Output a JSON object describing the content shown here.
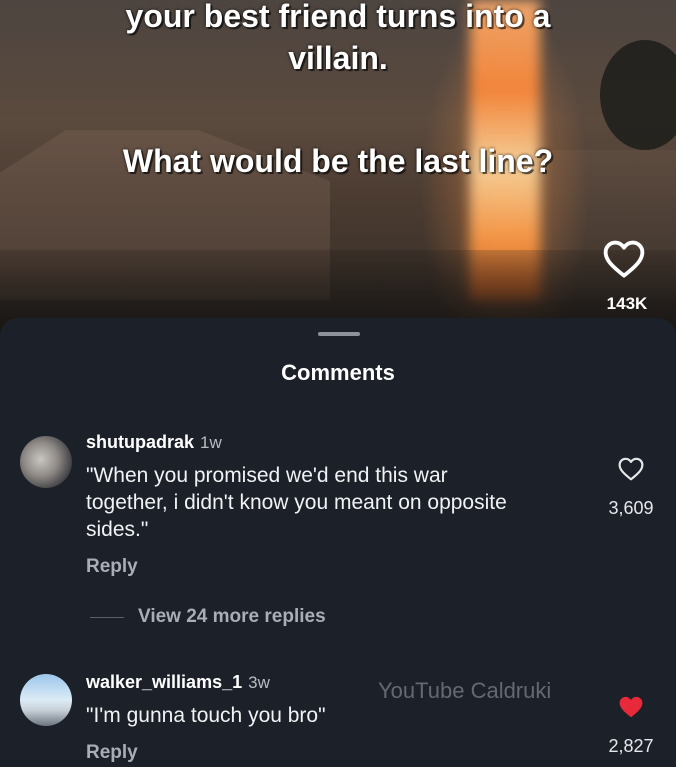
{
  "video": {
    "caption_line1": "your best friend turns into a",
    "caption_line2": "villain.",
    "caption_question": "What would be the last line?",
    "like_icon": "heart-outline-icon",
    "like_count": "143K"
  },
  "comments_sheet": {
    "title": "Comments",
    "comments": [
      {
        "username": "shutupadrak",
        "age": "1w",
        "text_lines": [
          "\"When you promised we'd end this war",
          "together, i didn't know you meant on opposite",
          "sides.\""
        ],
        "reply_label": "Reply",
        "view_more": "View 24 more replies",
        "like_icon": "heart-outline-icon",
        "like_count": "3,609"
      },
      {
        "username": "walker_williams_1",
        "age": "3w",
        "text_lines": [
          "\"I'm gunna touch you bro\""
        ],
        "reply_label": "Reply",
        "like_icon": "heart-filled-icon",
        "like_color": "#e8293a",
        "like_count": "2,827"
      }
    ],
    "watermark": "YouTube Caldruki"
  }
}
